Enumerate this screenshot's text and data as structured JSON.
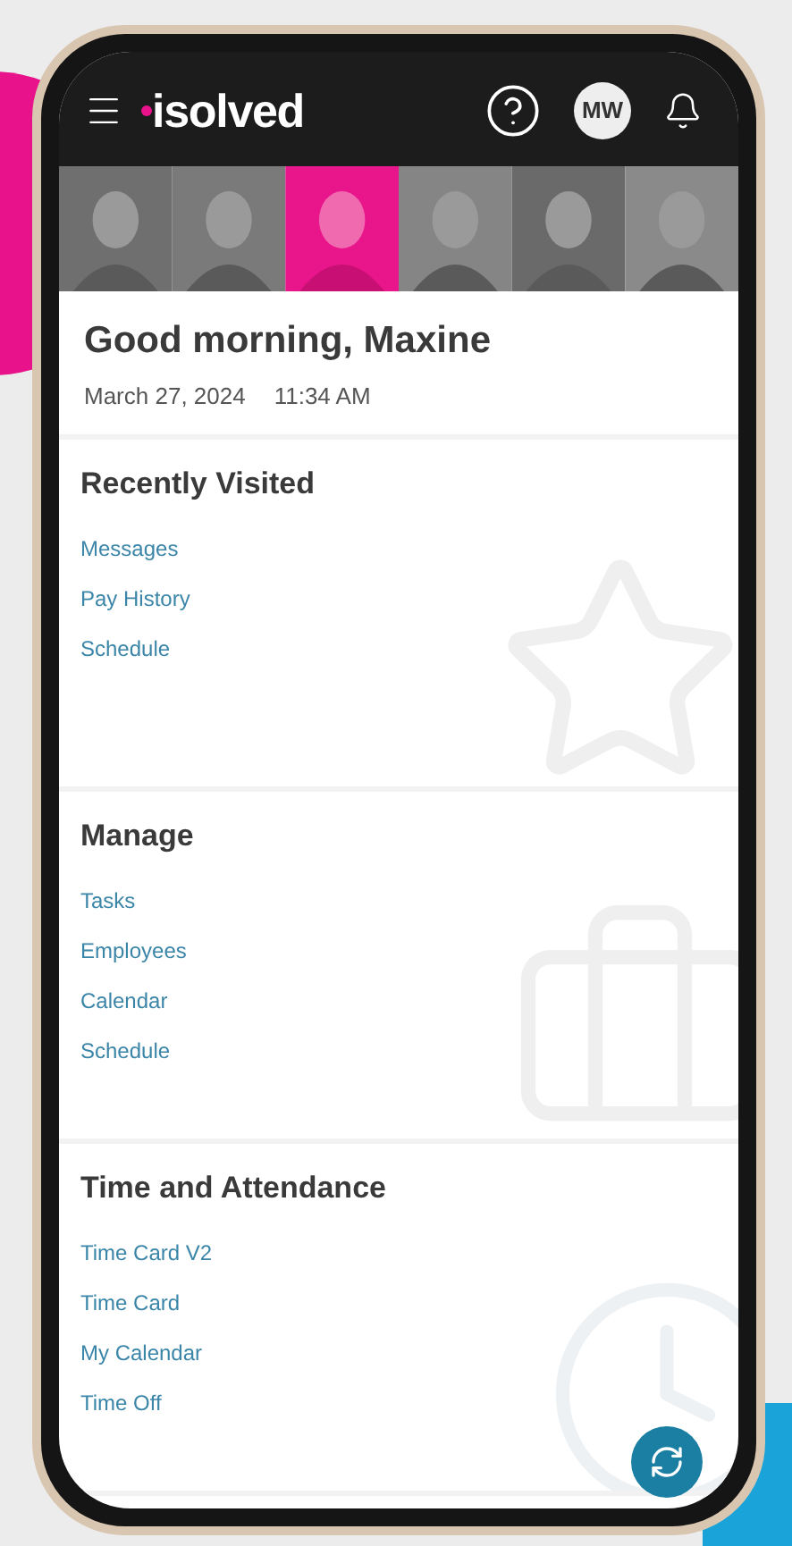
{
  "header": {
    "logo": "isolved",
    "avatar": "MW"
  },
  "greeting": {
    "title": "Good morning, Maxine",
    "date": "March 27, 2024",
    "time": "11:34 AM"
  },
  "sections": [
    {
      "kind": "star",
      "title": "Recently Visited",
      "links": [
        "Messages",
        "Pay History",
        "Schedule"
      ]
    },
    {
      "kind": "briefcase",
      "title": "Manage",
      "links": [
        "Tasks",
        "Employees",
        "Calendar",
        "Schedule"
      ]
    },
    {
      "kind": "clock",
      "title": "Time and Attendance",
      "links": [
        "Time Card V2",
        "Time Card",
        "My Calendar",
        "Time Off"
      ]
    }
  ]
}
